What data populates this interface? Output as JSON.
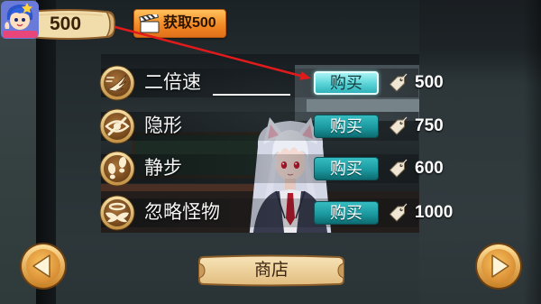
{
  "hud": {
    "coins": "500",
    "get_coins_button": {
      "label": "获取500",
      "icon": "clapperboard-icon"
    }
  },
  "shop": {
    "price_icon": "price-tag-icon",
    "items": [
      {
        "name": "二倍速",
        "icon": "double-speed-icon",
        "buy_label": "购买",
        "price": "500",
        "highlighted": true
      },
      {
        "name": "隐形",
        "icon": "invisible-icon",
        "buy_label": "购买",
        "price": "750",
        "highlighted": false
      },
      {
        "name": "静步",
        "icon": "footsteps-icon",
        "buy_label": "购买",
        "price": "600",
        "highlighted": false
      },
      {
        "name": "忽略怪物",
        "icon": "ignore-monsters-icon",
        "buy_label": "购买",
        "price": "1000",
        "highlighted": false
      }
    ]
  },
  "footer": {
    "shop_button": {
      "label": "商店"
    },
    "prev_icon": "arrow-left-icon",
    "next_icon": "arrow-right-icon"
  },
  "colors": {
    "buy_button": "#1b9aa0",
    "buy_button_highlight": "#5fd6d9",
    "get_coins_button": "#f48a24",
    "parchment": "#f0d9a8",
    "badge_gold": "#d4a04c",
    "annotation_arrow": "#e11b1b"
  }
}
